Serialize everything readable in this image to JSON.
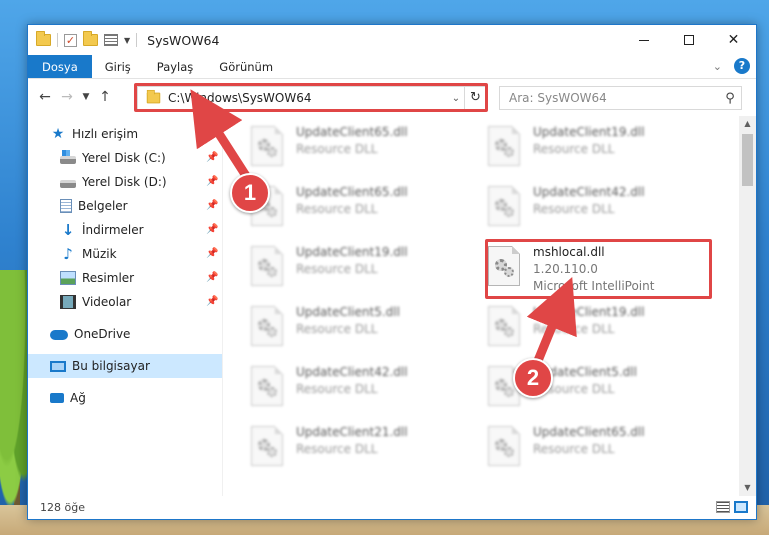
{
  "window": {
    "title": "SysWOW64"
  },
  "ribbon": {
    "tabs": [
      "Dosya",
      "Giriş",
      "Paylaş",
      "Görünüm"
    ]
  },
  "address": {
    "path": "C:\\Windows\\SysWOW64"
  },
  "search": {
    "placeholder": "Ara: SysWOW64"
  },
  "sidebar": {
    "quick_access": "Hızlı erişim",
    "items": [
      {
        "label": "Yerel Disk (C:)",
        "icon": "drive-c-icon",
        "pinned": true
      },
      {
        "label": "Yerel Disk (D:)",
        "icon": "drive-d-icon",
        "pinned": true
      },
      {
        "label": "Belgeler",
        "icon": "documents-icon",
        "pinned": true
      },
      {
        "label": "İndirmeler",
        "icon": "downloads-icon",
        "pinned": true
      },
      {
        "label": "Müzik",
        "icon": "music-icon",
        "pinned": true
      },
      {
        "label": "Resimler",
        "icon": "pictures-icon",
        "pinned": true
      },
      {
        "label": "Videolar",
        "icon": "videos-icon",
        "pinned": true
      }
    ],
    "onedrive": "OneDrive",
    "this_pc": "Bu bilgisayar",
    "network": "Ağ"
  },
  "files": [
    {
      "name": "UpdateClient65.dll",
      "sub": "Resource DLL"
    },
    {
      "name": "UpdateClient19.dll",
      "sub": "Resource DLL"
    },
    {
      "name": "UpdateClient65.dll",
      "sub": "Resource DLL"
    },
    {
      "name": "UpdateClient42.dll",
      "sub": "Resource DLL"
    },
    {
      "name": "UpdateClient19.dll",
      "sub": "Resource DLL"
    },
    {
      "name": "mshlocal.dll",
      "sub": "1.20.110.0",
      "sub2": "Microsoft IntelliPoint"
    },
    {
      "name": "UpdateClient5.dll",
      "sub": "Resource DLL"
    },
    {
      "name": "UpdateClient19.dll",
      "sub": "Resource DLL"
    },
    {
      "name": "UpdateClient42.dll",
      "sub": "Resource DLL"
    },
    {
      "name": "UpdateClient5.dll",
      "sub": "Resource DLL"
    },
    {
      "name": "UpdateClient21.dll",
      "sub": "Resource DLL"
    },
    {
      "name": "UpdateClient65.dll",
      "sub": "Resource DLL"
    }
  ],
  "status": {
    "count": "128 öğe"
  },
  "annotations": {
    "step1": "1",
    "step2": "2",
    "color": "#e04646"
  }
}
